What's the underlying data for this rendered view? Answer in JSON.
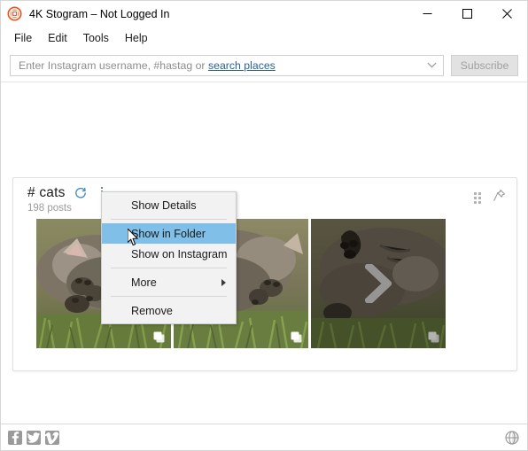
{
  "window": {
    "title": "4K Stogram – Not Logged In",
    "app_icon": "stogram-app-icon",
    "controls": {
      "minimize": "minimize-icon",
      "maximize": "maximize-icon",
      "close": "close-icon"
    }
  },
  "menubar": {
    "items": [
      {
        "label": "File"
      },
      {
        "label": "Edit"
      },
      {
        "label": "Tools"
      },
      {
        "label": "Help"
      }
    ]
  },
  "search": {
    "placeholder_prefix": "Enter Instagram username, #hastag or ",
    "placeholder_link": "search places",
    "value": "",
    "dropdown_icon": "chevron-down-icon",
    "subscribe_label": "Subscribe",
    "subscribe_enabled": false
  },
  "card": {
    "title": "# cats",
    "post_count": "198 posts",
    "refresh_icon": "refresh-icon",
    "overflow_icon": "more-vertical-icon",
    "drag_handle_icon": "drag-handle-icon",
    "pin_icon": "pin-icon",
    "thumbnails": [
      {
        "name": "thumbnail-1",
        "alt": "tabby cat lying on grass",
        "multi": true,
        "dimmed": false,
        "next_arrow": false
      },
      {
        "name": "thumbnail-2",
        "alt": "tabby cat lying on grass",
        "multi": true,
        "dimmed": false,
        "next_arrow": false
      },
      {
        "name": "thumbnail-3",
        "alt": "tabby cat lying on grass",
        "multi": true,
        "dimmed": true,
        "next_arrow": true
      }
    ],
    "next_arrow_icon": "chevron-right-icon"
  },
  "context_menu": {
    "items": [
      {
        "label": "Show Details",
        "selected": false,
        "submenu": false,
        "separator_after": true
      },
      {
        "label": "Show in Folder",
        "selected": true,
        "submenu": false,
        "separator_after": false
      },
      {
        "label": "Show on Instagram",
        "selected": false,
        "submenu": false,
        "separator_after": true
      },
      {
        "label": "More",
        "selected": false,
        "submenu": true,
        "separator_after": true
      },
      {
        "label": "Remove",
        "selected": false,
        "submenu": false,
        "separator_after": false
      }
    ]
  },
  "statusbar": {
    "social": [
      {
        "name": "facebook-icon",
        "glyph": "f"
      },
      {
        "name": "twitter-icon",
        "glyph": "t"
      },
      {
        "name": "vimeo-icon",
        "glyph": "V"
      }
    ],
    "language_icon": "globe-icon"
  },
  "colors": {
    "accent_blue": "#2a6099",
    "menu_highlight": "#7fbfe8",
    "refresh_blue": "#4a8ec2",
    "app_orange": "#e8521f",
    "social_gray": "#9a9a9a"
  }
}
